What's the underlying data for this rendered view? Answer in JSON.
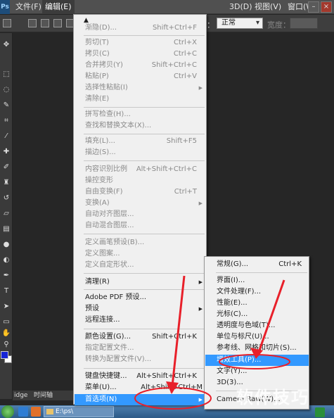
{
  "menubar": {
    "logo": "Ps",
    "items": [
      "文件(F)",
      "编辑(E)",
      "3D(D)",
      "视图(V)",
      "窗口(W)"
    ],
    "window_min": "–",
    "window_close": "×"
  },
  "options_bar": {
    "style_label": "式：",
    "style_value": "正常",
    "width_label": "宽度："
  },
  "bottom_panel": {
    "tab1": "idge",
    "tab2": "时间轴"
  },
  "taskbar": {
    "folder_label": "E:\\ps\\"
  },
  "edit_menu": {
    "items": [
      {
        "label": "渐隐(D)...",
        "shortcut": "Shift+Ctrl+F",
        "disabled": true
      },
      {
        "label": "剪切(T)",
        "shortcut": "Ctrl+X",
        "disabled": true
      },
      {
        "label": "拷贝(C)",
        "shortcut": "Ctrl+C",
        "disabled": true
      },
      {
        "label": "合并拷贝(Y)",
        "shortcut": "Shift+Ctrl+C",
        "disabled": true
      },
      {
        "label": "粘贴(P)",
        "shortcut": "Ctrl+V",
        "disabled": true
      },
      {
        "label": "选择性粘贴(I)",
        "shortcut": "",
        "disabled": true,
        "submenu": true
      },
      {
        "label": "清除(E)",
        "shortcut": "",
        "disabled": true
      },
      {
        "label": "拼写检查(H)...",
        "shortcut": "",
        "disabled": true
      },
      {
        "label": "查找和替换文本(X)...",
        "shortcut": "",
        "disabled": true
      },
      {
        "label": "填充(L)...",
        "shortcut": "Shift+F5",
        "disabled": true
      },
      {
        "label": "描边(S)...",
        "shortcut": "",
        "disabled": true
      },
      {
        "label": "内容识别比例",
        "shortcut": "Alt+Shift+Ctrl+C",
        "disabled": true
      },
      {
        "label": "操控变形",
        "shortcut": "",
        "disabled": true
      },
      {
        "label": "自由变换(F)",
        "shortcut": "Ctrl+T",
        "disabled": true
      },
      {
        "label": "变换(A)",
        "shortcut": "",
        "disabled": true,
        "submenu": true
      },
      {
        "label": "自动对齐图层...",
        "shortcut": "",
        "disabled": true
      },
      {
        "label": "自动混合图层...",
        "shortcut": "",
        "disabled": true
      },
      {
        "label": "定义画笔预设(B)...",
        "shortcut": "",
        "disabled": true
      },
      {
        "label": "定义图案...",
        "shortcut": "",
        "disabled": true
      },
      {
        "label": "定义自定形状...",
        "shortcut": "",
        "disabled": true
      },
      {
        "label": "清理(R)",
        "shortcut": "",
        "disabled": false,
        "submenu": true
      },
      {
        "label": "Adobe PDF 预设...",
        "shortcut": "",
        "disabled": false
      },
      {
        "label": "预设",
        "shortcut": "",
        "disabled": false,
        "submenu": true
      },
      {
        "label": "远程连接...",
        "shortcut": "",
        "disabled": false
      },
      {
        "label": "颜色设置(G)...",
        "shortcut": "Shift+Ctrl+K",
        "disabled": false
      },
      {
        "label": "指定配置文件...",
        "shortcut": "",
        "disabled": true
      },
      {
        "label": "转换为配置文件(V)...",
        "shortcut": "",
        "disabled": true
      },
      {
        "label": "键盘快捷键...",
        "shortcut": "Alt+Shift+Ctrl+K",
        "disabled": false
      },
      {
        "label": "菜单(U)...",
        "shortcut": "Alt+Shift+Ctrl+M",
        "disabled": false
      },
      {
        "label": "首选项(N)",
        "shortcut": "",
        "disabled": false,
        "submenu": true,
        "highlighted": true
      }
    ]
  },
  "preferences_menu": {
    "items": [
      {
        "label": "常规(G)...",
        "shortcut": "Ctrl+K"
      },
      {
        "label": "界面(I)...",
        "shortcut": ""
      },
      {
        "label": "文件处理(F)...",
        "shortcut": ""
      },
      {
        "label": "性能(E)...",
        "shortcut": ""
      },
      {
        "label": "光标(C)...",
        "shortcut": ""
      },
      {
        "label": "透明度与色域(T)...",
        "shortcut": ""
      },
      {
        "label": "单位与标尺(U)...",
        "shortcut": ""
      },
      {
        "label": "参考线、网格和切片(S)...",
        "shortcut": ""
      },
      {
        "label": "增效工具(P)...",
        "shortcut": "",
        "highlighted": true
      },
      {
        "label": "文字(Y)...",
        "shortcut": ""
      },
      {
        "label": "3D(3)...",
        "shortcut": ""
      },
      {
        "label": "Camera Raw(W)...",
        "shortcut": ""
      }
    ]
  },
  "watermark": "软件技巧",
  "colors": {
    "highlight": "#3399ff",
    "annotation": "#e8202a",
    "menu_bg": "#f0f0f0",
    "foreground_swatch": "#1624d6"
  }
}
